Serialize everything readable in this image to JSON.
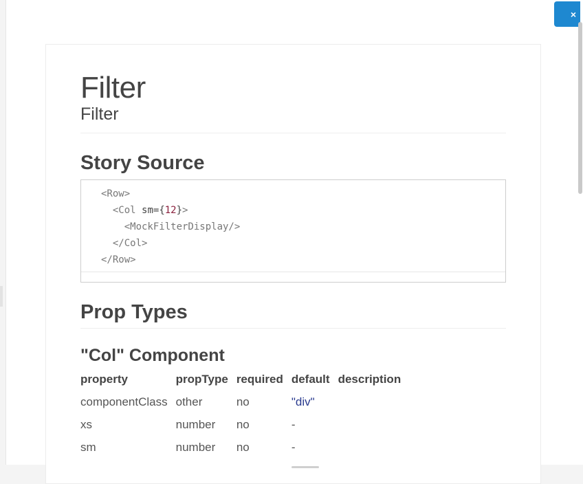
{
  "close_button": {
    "label": "×"
  },
  "page": {
    "title": "Filter",
    "subtitle": "Filter"
  },
  "story_source": {
    "heading": "Story Source",
    "code_lines": [
      {
        "indent": "",
        "parts": [
          "<Row>"
        ]
      },
      {
        "indent": "  ",
        "tag_open": "<Col ",
        "attr": "sm=",
        "brace_open": "{",
        "num": "12",
        "brace_close": "}",
        "tag_close": ">"
      },
      {
        "indent": "    ",
        "parts": [
          "<MockFilterDisplay/>"
        ]
      },
      {
        "indent": "  ",
        "parts": [
          "</Col>"
        ]
      },
      {
        "indent": "",
        "parts": [
          "</Row>"
        ]
      }
    ]
  },
  "prop_types": {
    "heading": "Prop Types",
    "component_heading": "\"Col\" Component",
    "columns": [
      "property",
      "propType",
      "required",
      "default",
      "description"
    ],
    "rows": [
      {
        "property": "componentClass",
        "propType": "other",
        "required": "no",
        "default": "\"div\"",
        "description": ""
      },
      {
        "property": "xs",
        "propType": "number",
        "required": "no",
        "default": "-",
        "description": ""
      },
      {
        "property": "sm",
        "propType": "number",
        "required": "no",
        "default": "-",
        "description": ""
      }
    ]
  },
  "colors": {
    "accent": "#1e88d0",
    "code_number": "#8a1f3c",
    "default_string": "#2a3b8f"
  }
}
